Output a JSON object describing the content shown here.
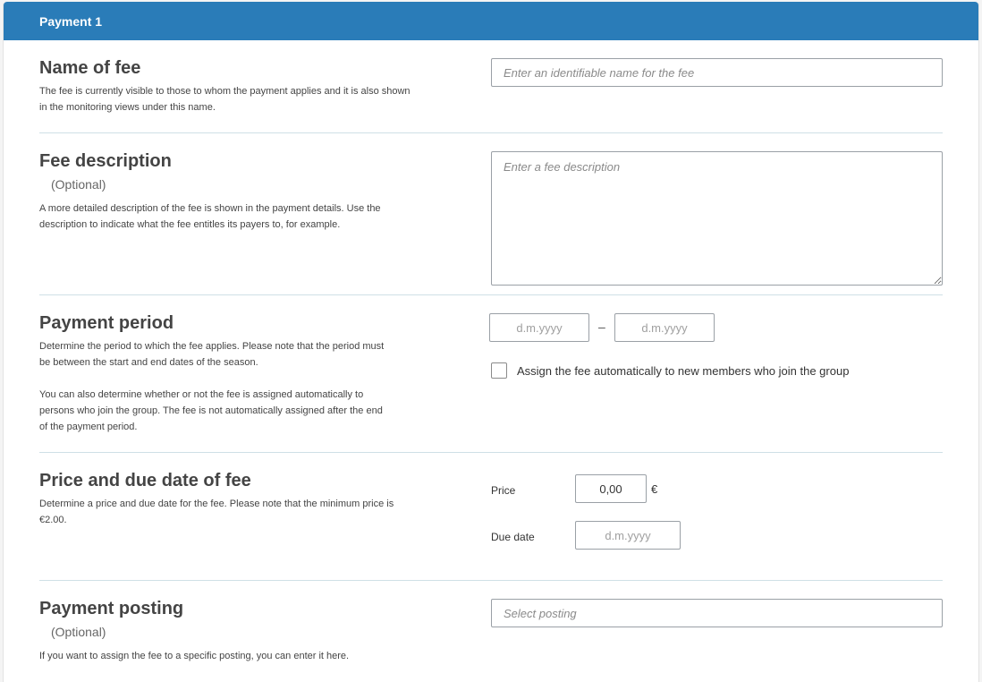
{
  "header": {
    "title": "Payment 1"
  },
  "name_of_fee": {
    "title": "Name of fee",
    "description": "The fee is currently visible to those to whom the payment applies and it is also shown in the monitoring views under this name.",
    "placeholder": "Enter an identifiable name for the fee"
  },
  "fee_description": {
    "title": "Fee description",
    "optional": "(Optional)",
    "description": "A more detailed description of the fee is shown in the payment details. Use the description to indicate what the fee entitles its payers to, for example.",
    "placeholder": "Enter a fee description"
  },
  "payment_period": {
    "title": "Payment period",
    "description1": "Determine the period to which the fee applies. Please note that the period must be between the start and end dates of the season.",
    "description2": "You can also determine whether or not the fee is assigned automatically to persons who join the group. The fee is not automatically assigned after the end of the payment period.",
    "start_placeholder": "d.m.yyyy",
    "separator": "–",
    "end_placeholder": "d.m.yyyy",
    "auto_assign_label": "Assign the fee automatically to new members who join the group"
  },
  "price": {
    "title": "Price and due date of fee",
    "description": "Determine a price and due date for the fee. Please note that the minimum price is €2.00.",
    "price_label": "Price",
    "price_value": "0,00",
    "currency": "€",
    "due_label": "Due date",
    "due_placeholder": "d.m.yyyy"
  },
  "posting": {
    "title": "Payment posting",
    "optional": "(Optional)",
    "description": "If you want to assign the fee to a specific posting, you can enter it here.",
    "placeholder": "Select posting"
  }
}
